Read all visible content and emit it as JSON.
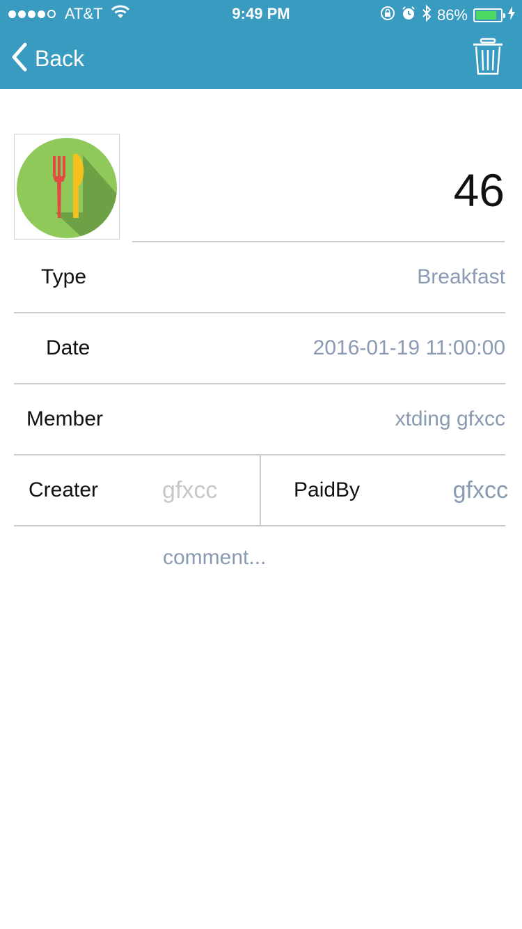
{
  "status_bar": {
    "carrier": "AT&T",
    "time": "9:49 PM",
    "battery_percent": "86%",
    "battery_level": 0.86,
    "signal_bars_filled": 4,
    "signal_bars_total": 5
  },
  "nav": {
    "back_label": "Back",
    "delete_icon": "trash-icon"
  },
  "record": {
    "icon": "fork-knife-icon",
    "amount": "46"
  },
  "fields": {
    "type_label": "Type",
    "type_value": "Breakfast",
    "date_label": "Date",
    "date_value": "2016-01-19 11:00:00",
    "member_label": "Member",
    "member_value": "xtding gfxcc",
    "creater_label": "Creater",
    "creater_value": "gfxcc",
    "paidby_label": "PaidBy",
    "paidby_value": "gfxcc"
  },
  "comment": {
    "placeholder": "comment..."
  },
  "colors": {
    "header": "#3a9bc1",
    "value_text": "#8a9ab2",
    "disabled_text": "#c8c8c8",
    "battery": "#4cd964"
  }
}
